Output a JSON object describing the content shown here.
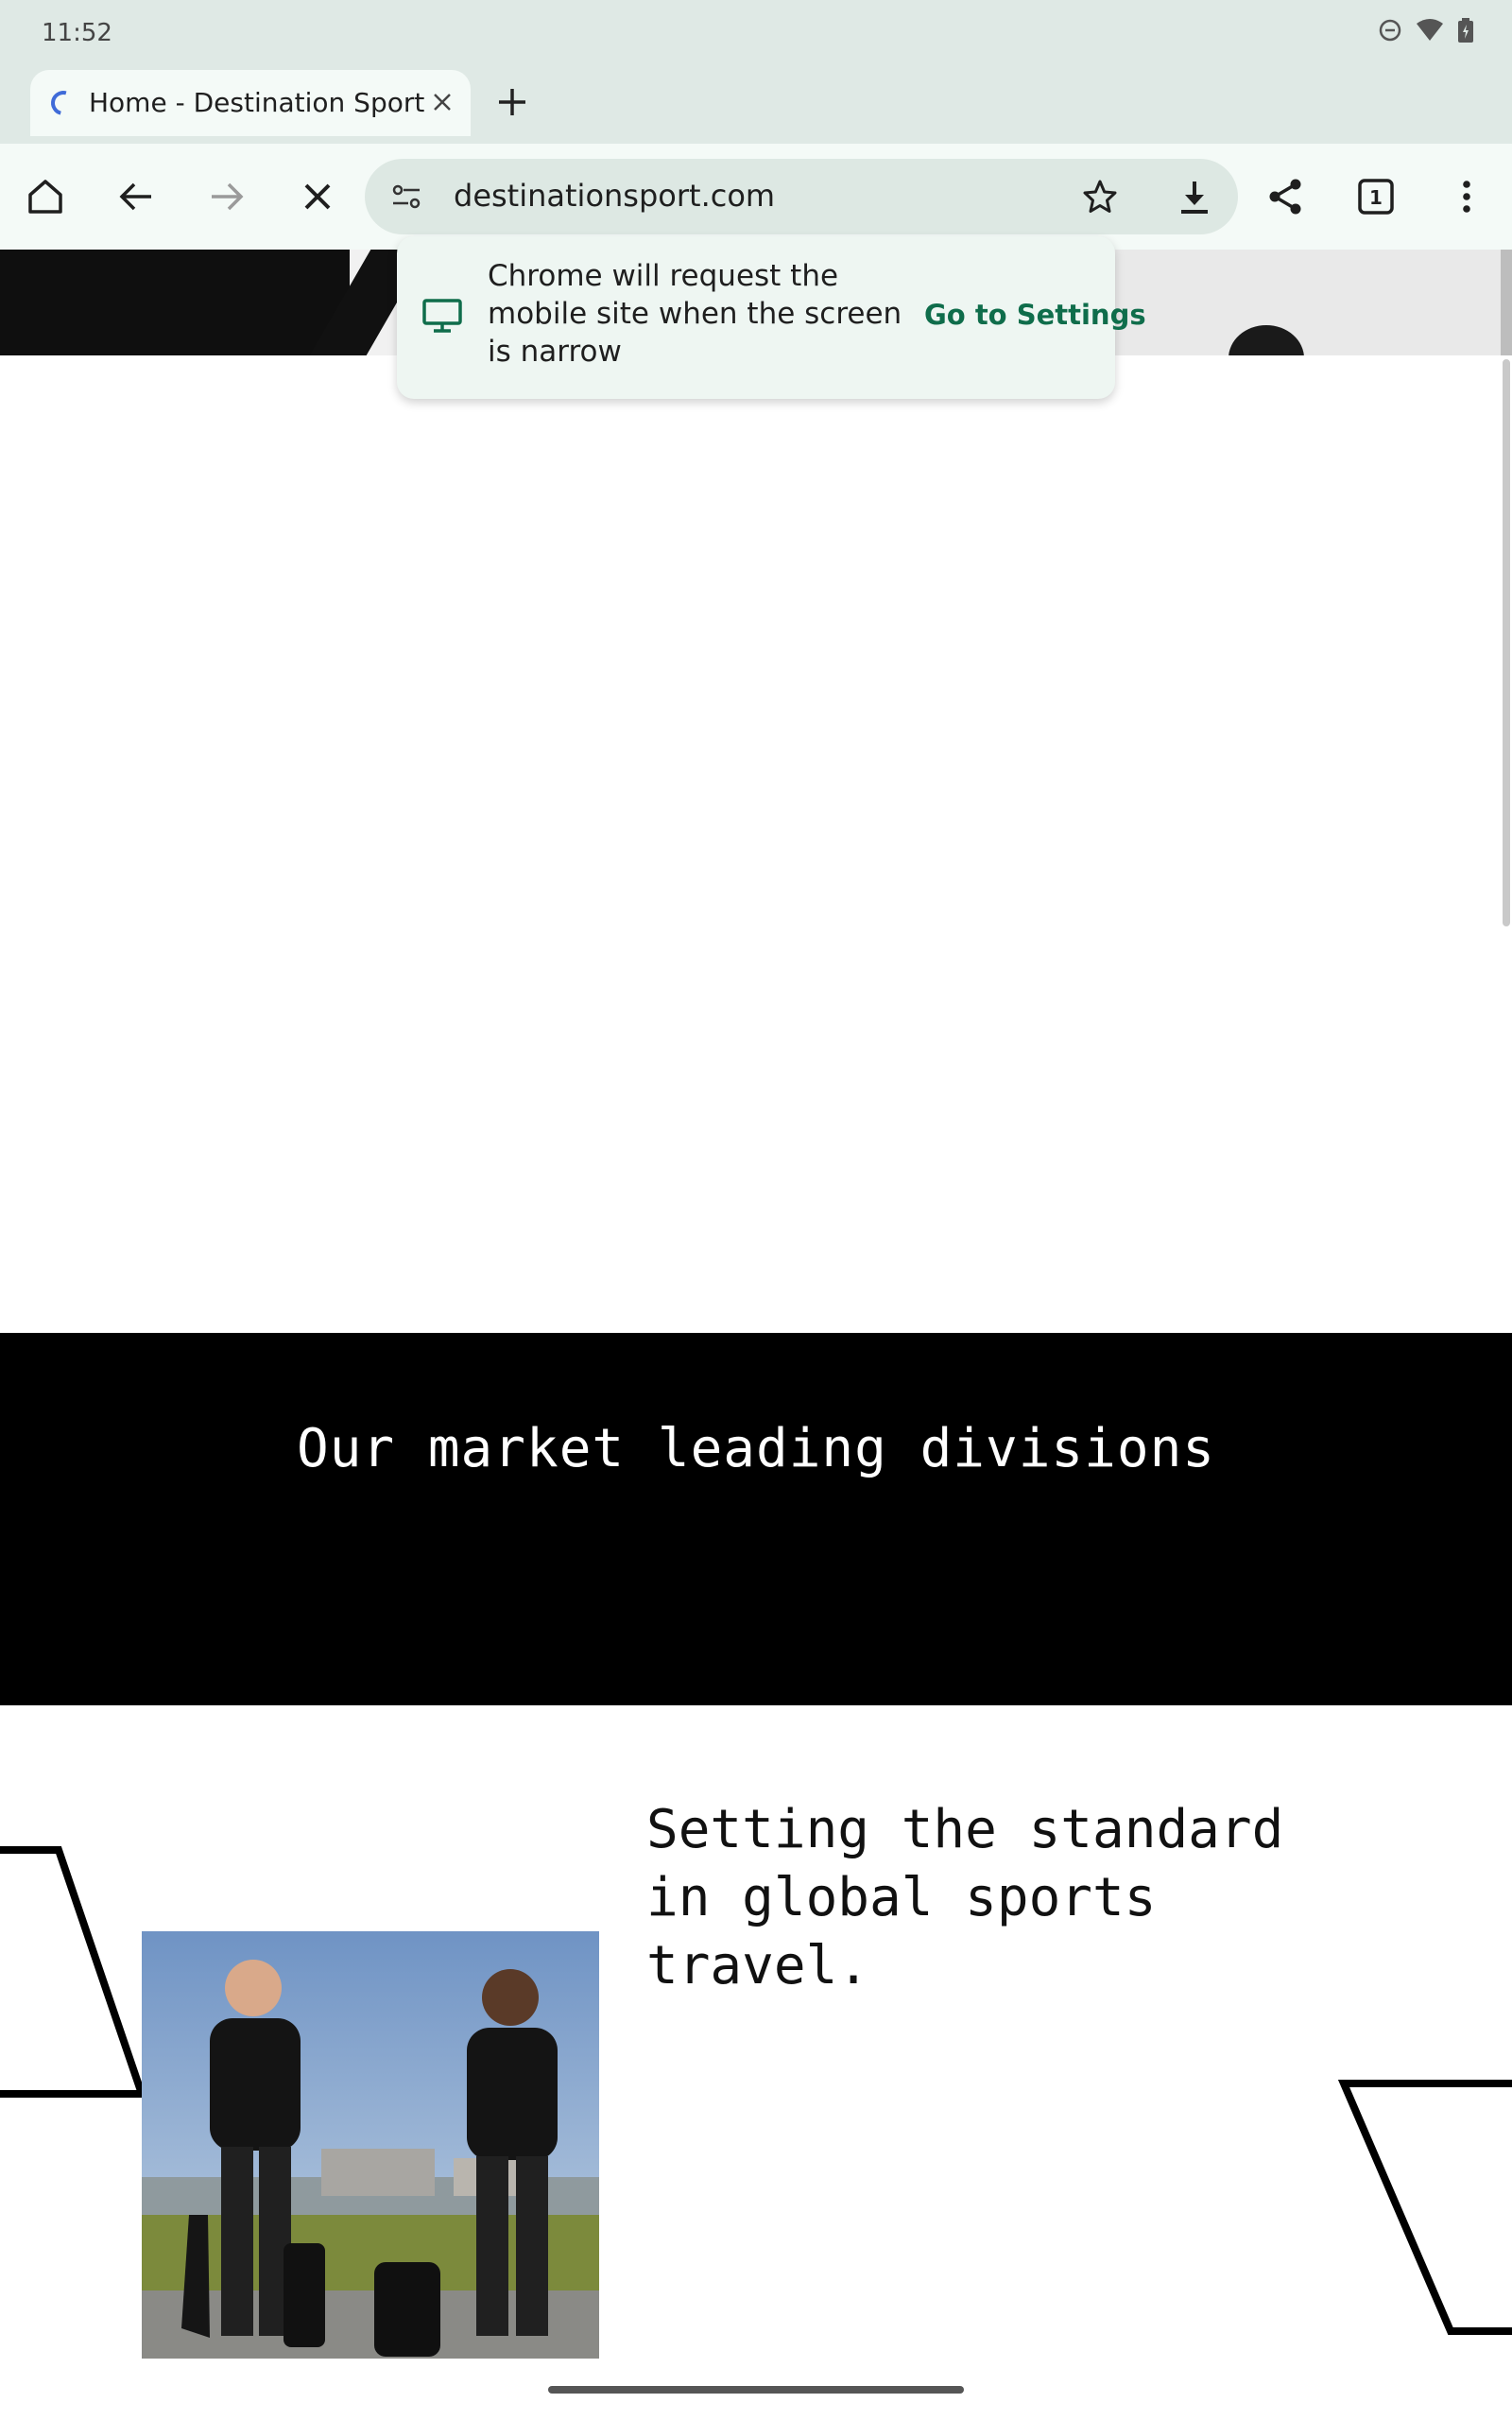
{
  "status_bar": {
    "time": "11:52"
  },
  "tab": {
    "title": "Home - Destination Sport"
  },
  "toolbar": {
    "url": "destinationsport.com",
    "tab_count": "1"
  },
  "popup": {
    "message": "Chrome will request the mobile site when the screen is narrow",
    "action": "Go to Settings"
  },
  "page": {
    "band_heading": "Our market leading divisions",
    "tagline": "Setting the standard in global sports travel."
  },
  "colors": {
    "chrome_bg": "#dfe9e5",
    "toolbar_bg": "#f4faf7",
    "accent_green": "#0f6d4b",
    "band_black": "#000000"
  }
}
